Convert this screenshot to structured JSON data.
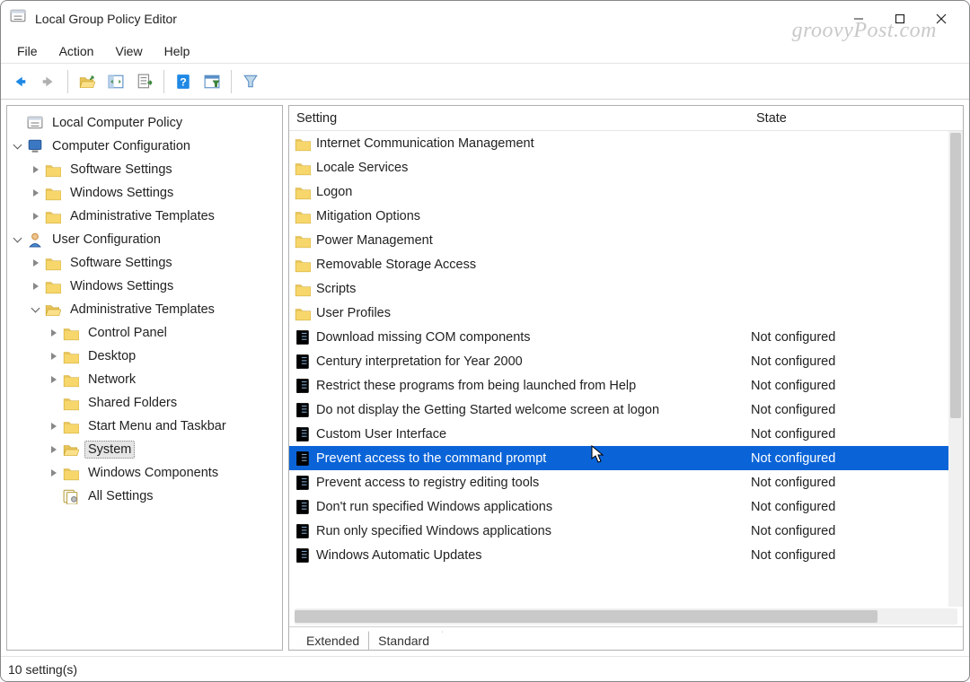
{
  "window": {
    "title": "Local Group Policy Editor"
  },
  "watermark": "groovyPost.com",
  "menu": [
    "File",
    "Action",
    "View",
    "Help"
  ],
  "toolbar_icons": [
    "back",
    "forward",
    "sep",
    "up-folder",
    "show-tree",
    "export-list",
    "sep",
    "help",
    "filter-options",
    "sep",
    "filter"
  ],
  "tree": {
    "root": "Local Computer Policy",
    "computer_config": "Computer Configuration",
    "cc_children": [
      "Software Settings",
      "Windows Settings",
      "Administrative Templates"
    ],
    "user_config": "User Configuration",
    "uc_children": [
      "Software Settings",
      "Windows Settings",
      "Administrative Templates"
    ],
    "at_children": [
      "Control Panel",
      "Desktop",
      "Network",
      "Shared Folders",
      "Start Menu and Taskbar",
      "System",
      "Windows Components",
      "All Settings"
    ],
    "selected": "System"
  },
  "columns": {
    "setting": "Setting",
    "state": "State"
  },
  "rows": [
    {
      "type": "folder",
      "name": "Internet Communication Management"
    },
    {
      "type": "folder",
      "name": "Locale Services"
    },
    {
      "type": "folder",
      "name": "Logon"
    },
    {
      "type": "folder",
      "name": "Mitigation Options"
    },
    {
      "type": "folder",
      "name": "Power Management"
    },
    {
      "type": "folder",
      "name": "Removable Storage Access"
    },
    {
      "type": "folder",
      "name": "Scripts"
    },
    {
      "type": "folder",
      "name": "User Profiles"
    },
    {
      "type": "policy",
      "name": "Download missing COM components",
      "state": "Not configured"
    },
    {
      "type": "policy",
      "name": "Century interpretation for Year 2000",
      "state": "Not configured"
    },
    {
      "type": "policy",
      "name": "Restrict these programs from being launched from Help",
      "state": "Not configured"
    },
    {
      "type": "policy",
      "name": "Do not display the Getting Started welcome screen at logon",
      "state": "Not configured"
    },
    {
      "type": "policy",
      "name": "Custom User Interface",
      "state": "Not configured"
    },
    {
      "type": "policy",
      "name": "Prevent access to the command prompt",
      "state": "Not configured",
      "selected": true
    },
    {
      "type": "policy",
      "name": "Prevent access to registry editing tools",
      "state": "Not configured"
    },
    {
      "type": "policy",
      "name": "Don't run specified Windows applications",
      "state": "Not configured"
    },
    {
      "type": "policy",
      "name": "Run only specified Windows applications",
      "state": "Not configured"
    },
    {
      "type": "policy",
      "name": "Windows Automatic Updates",
      "state": "Not configured"
    }
  ],
  "tabs": [
    "Extended",
    "Standard"
  ],
  "active_tab": "Standard",
  "status": "10 setting(s)"
}
